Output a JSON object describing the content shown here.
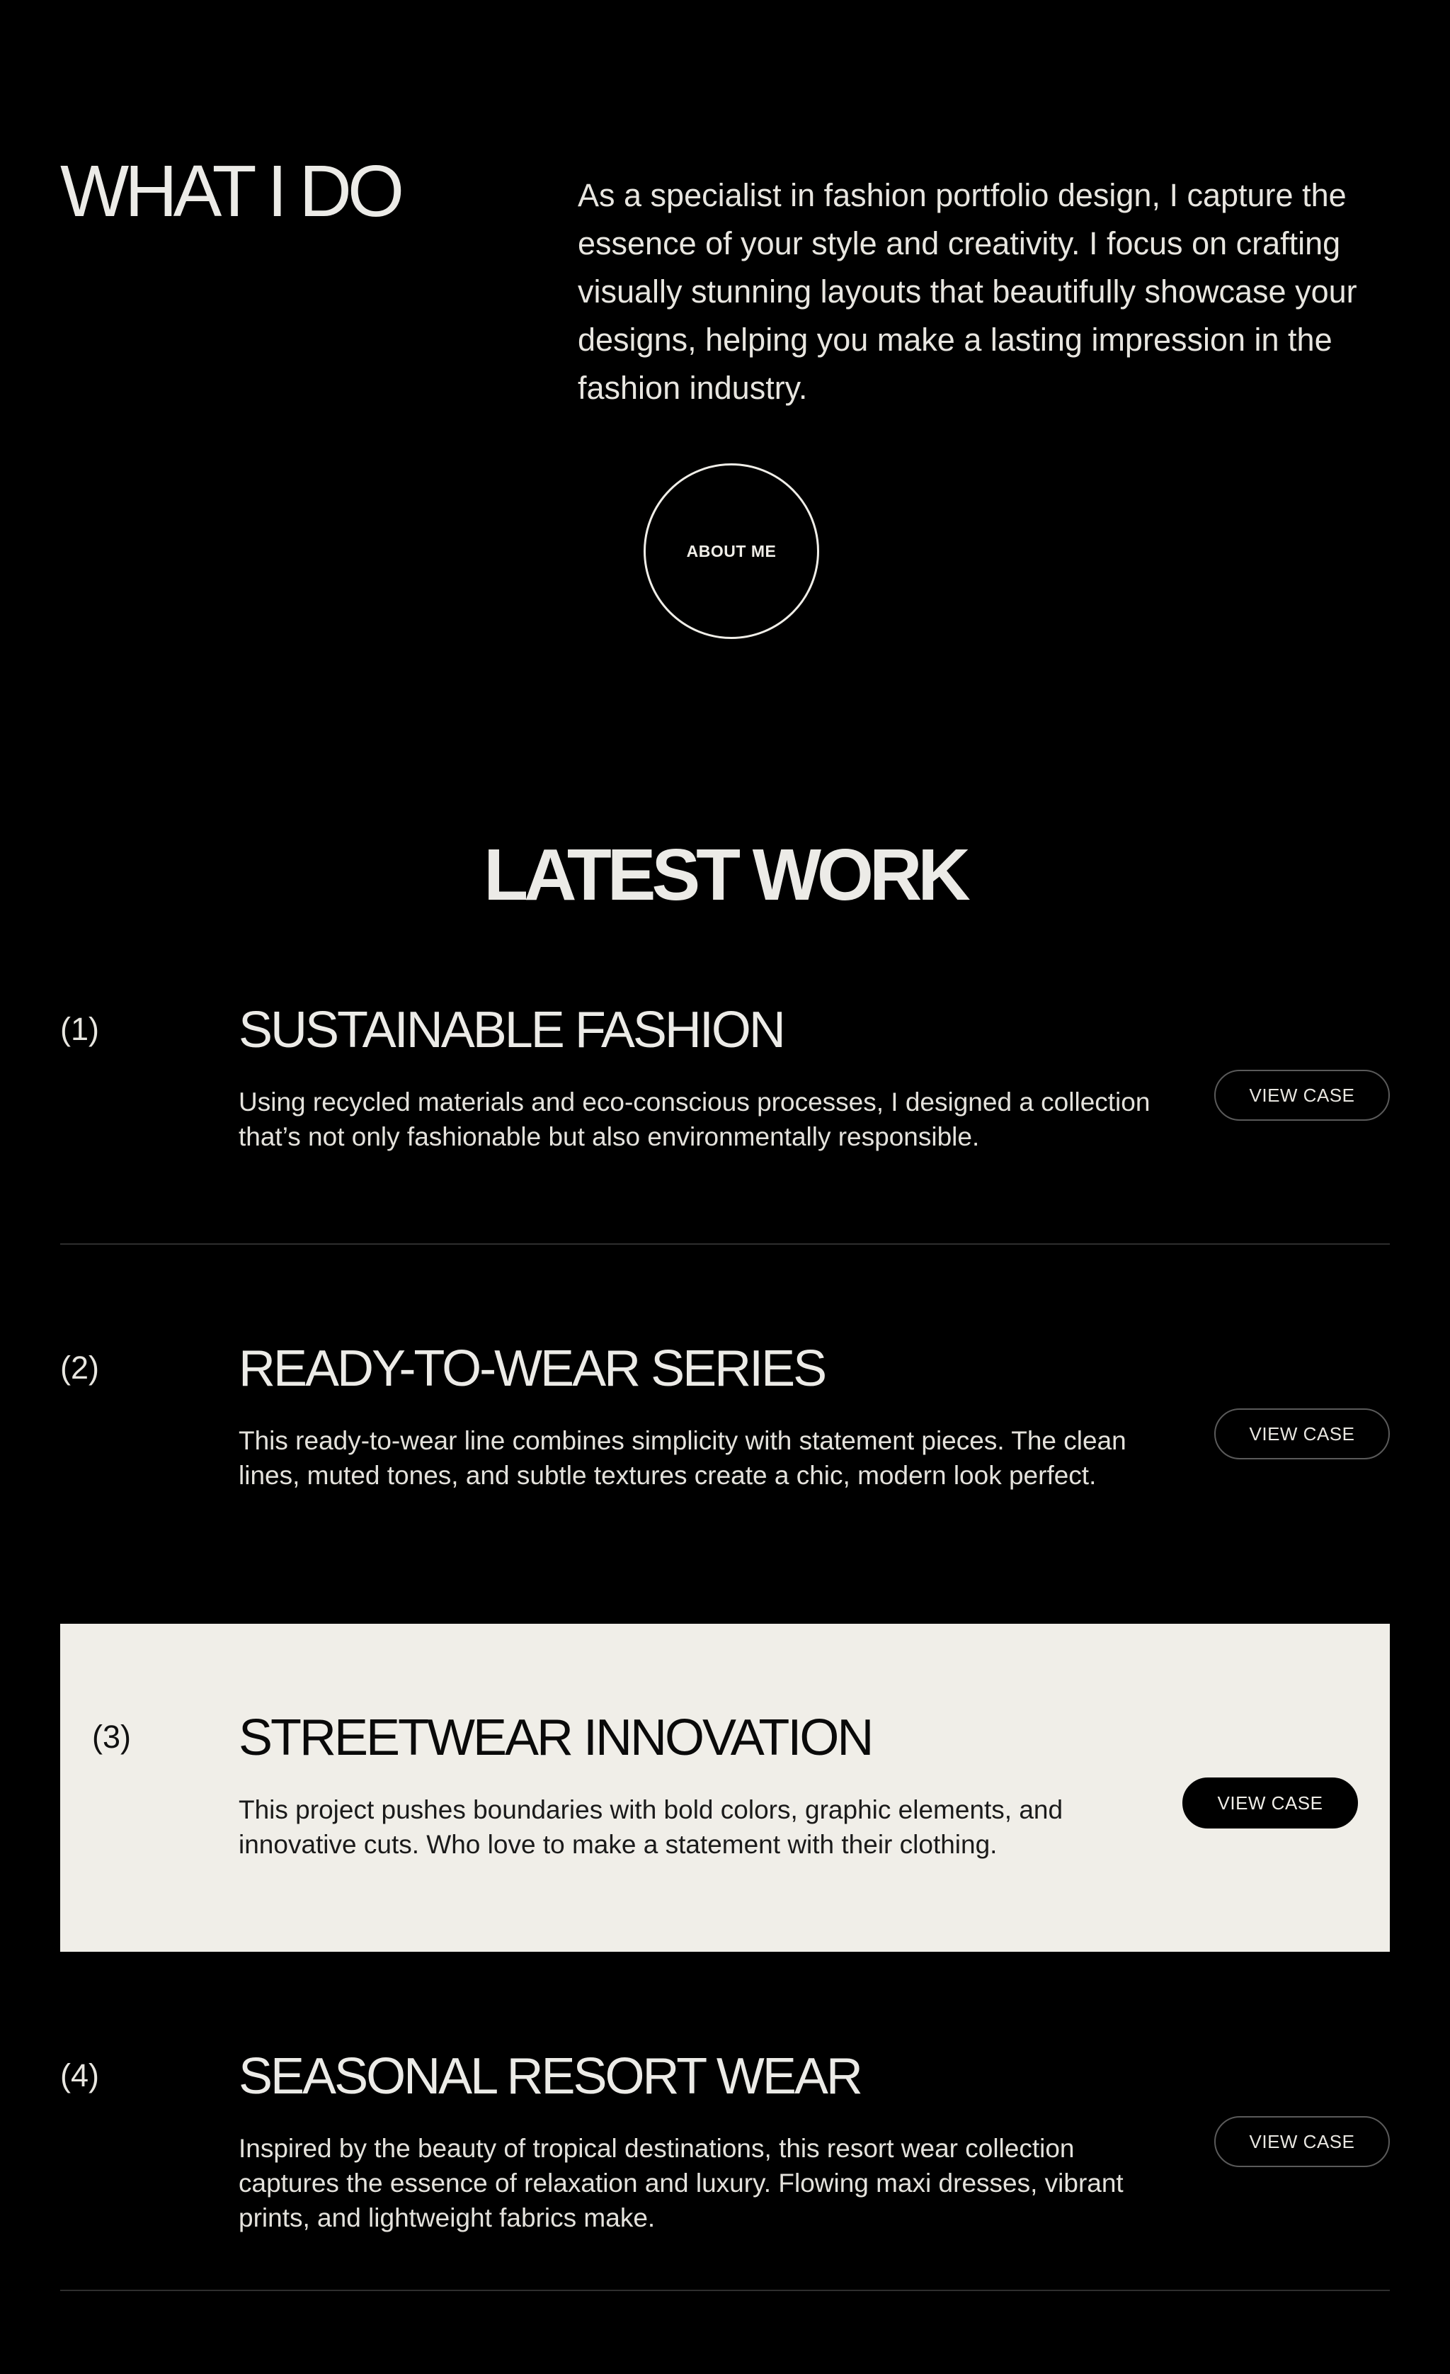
{
  "what_i_do": {
    "title": "WHAT I DO",
    "text": "As a specialist in fashion portfolio design, I capture the essence of your style and creativity. I focus on crafting visually stunning layouts that beautifully showcase your designs, helping you make a lasting impression in the fashion industry.",
    "about_button": "ABOUT ME"
  },
  "latest_work": {
    "title": "LATEST WORK",
    "items": [
      {
        "number": "(1)",
        "title": "SUSTAINABLE FASHION",
        "description": "Using recycled materials and eco-conscious processes, I designed a collection that’s not only fashionable but also environmentally responsible.",
        "button": "VIEW CASE"
      },
      {
        "number": "(2)",
        "title": "READY-TO-WEAR SERIES",
        "description": "This ready-to-wear line combines simplicity with statement pieces. The clean lines, muted tones, and subtle textures create a chic, modern look perfect.",
        "button": "VIEW CASE"
      },
      {
        "number": "(3)",
        "title": "STREETWEAR INNOVATION",
        "description": "This project pushes boundaries with bold colors, graphic elements, and innovative cuts. Who love to make a statement with their clothing.",
        "button": "VIEW CASE"
      },
      {
        "number": "(4)",
        "title": "SEASONAL RESORT WEAR",
        "description": "Inspired by the beauty of tropical destinations, this resort wear collection captures the essence of relaxation and luxury. Flowing maxi dresses, vibrant prints, and lightweight fabrics make.",
        "button": "VIEW CASE"
      }
    ]
  },
  "colors": {
    "background": "#000000",
    "text": "#f0eee8",
    "highlight_panel": "#f0eee8",
    "highlight_button": "#000000",
    "divider": "#2e2e2e"
  }
}
